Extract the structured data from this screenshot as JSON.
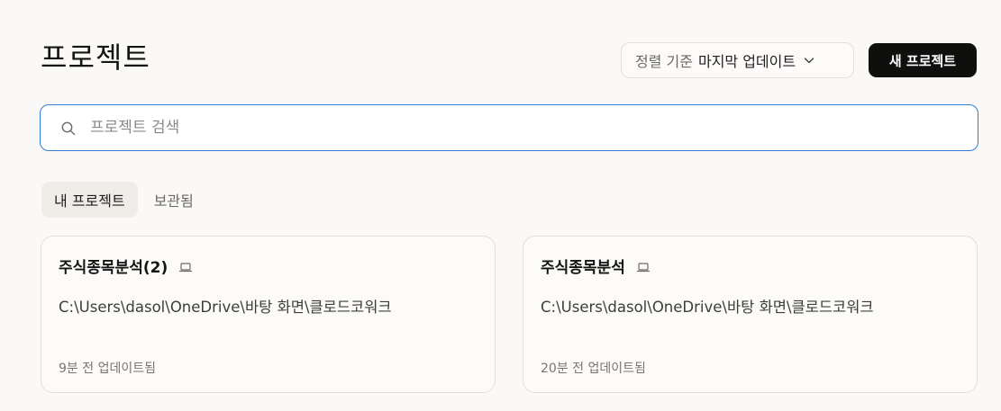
{
  "header": {
    "title": "프로젝트",
    "sort_prefix": "정렬 기준",
    "sort_value": "마지막 업데이트",
    "new_project_label": "새 프로젝트"
  },
  "search": {
    "placeholder": "프로젝트 검색",
    "value": ""
  },
  "tabs": [
    {
      "label": "내 프로젝트",
      "active": true
    },
    {
      "label": "보관됨",
      "active": false
    }
  ],
  "projects": [
    {
      "name": "주식종목분석(2)",
      "path": "C:\\Users\\dasol\\OneDrive\\바탕 화면\\클로드코워크",
      "updated": "9분 전 업데이트됨"
    },
    {
      "name": "주식종목분석",
      "path": "C:\\Users\\dasol\\OneDrive\\바탕 화면\\클로드코워크",
      "updated": "20분 전 업데이트됨"
    }
  ],
  "icons": {
    "search": "search-icon",
    "sort_chevron": "chevron-down-icon",
    "project_location": "laptop-icon"
  },
  "colors": {
    "background": "#faf9f7",
    "primary_button": "#0f0f0e",
    "search_focus": "#2f7fd8",
    "active_tab": "#efede8"
  }
}
